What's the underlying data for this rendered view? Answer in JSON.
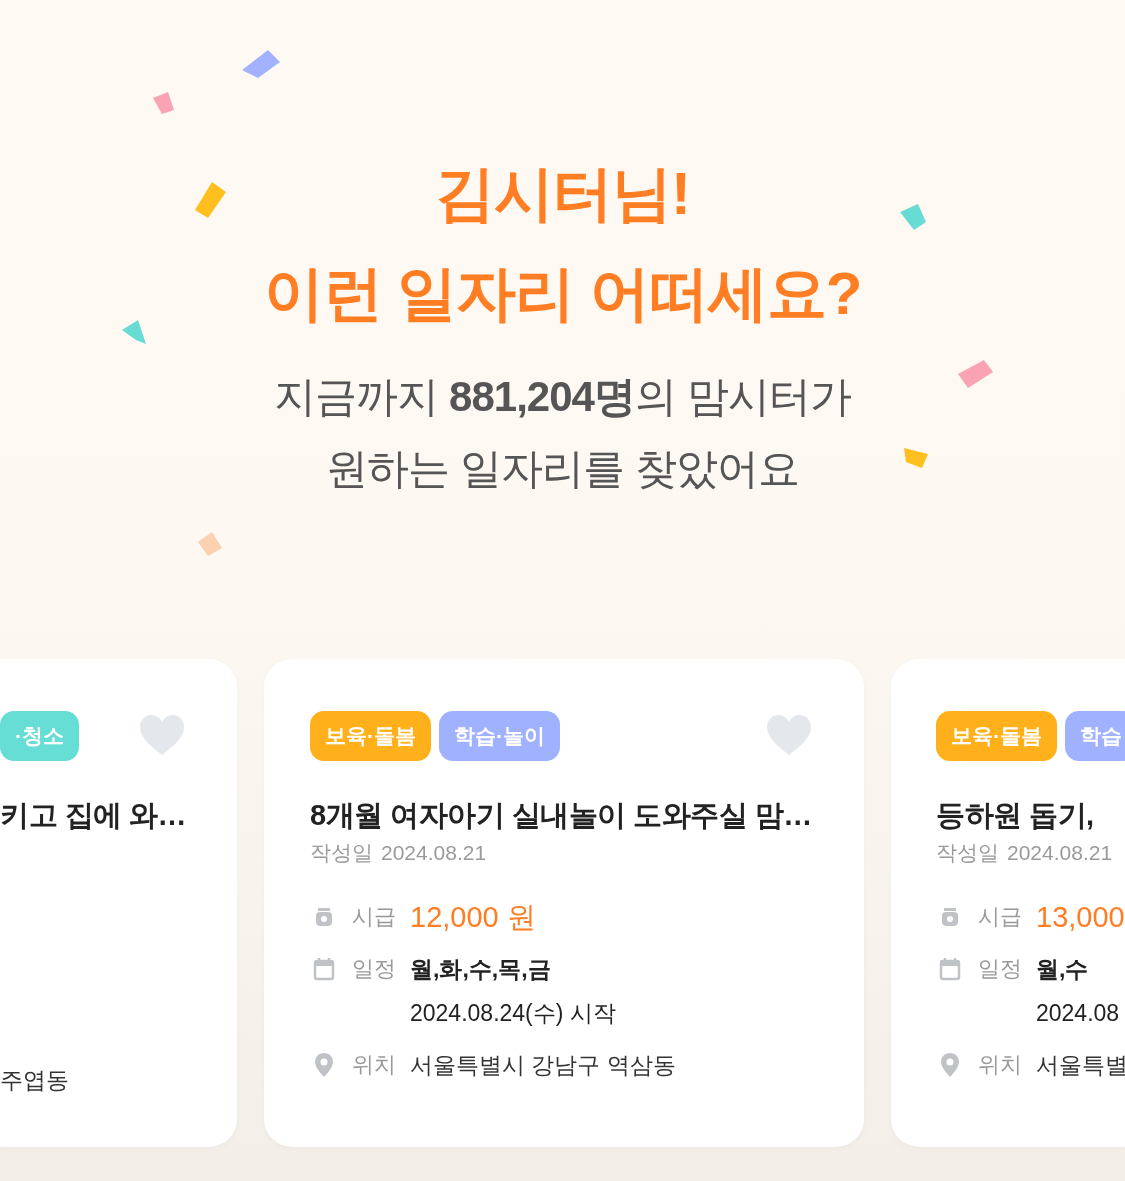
{
  "hero": {
    "title_lines": [
      "김시터님!",
      "이런 일자리 어떠세요?"
    ],
    "subtitle_lines": [
      "지금까지 **881,204명**의 맘시터가",
      "원하는 일자리를 찾았어요"
    ]
  },
  "cards": [
    {
      "kind": "cut-left",
      "liked": false,
      "tags": [
        {
          "label": "·청소",
          "color": "#66ddd5"
        }
      ],
      "title": "키고 집에 와…",
      "rows": [
        {
          "kind": "location",
          "value": "주엽동"
        }
      ]
    },
    {
      "kind": "whole",
      "liked": false,
      "tags": [
        {
          "label": "보육·돌봄",
          "color": "#ffb01a"
        },
        {
          "label": "학습·놀이",
          "color": "#9fb1ff"
        }
      ],
      "title": "8개월 여자아기 실내놀이 도와주실 맘…",
      "date_label": "작성일",
      "date": "2024.08.21",
      "rows": [
        {
          "kind": "wage",
          "label": "시급",
          "value": "12,000 원"
        },
        {
          "kind": "schedule",
          "label": "일정",
          "value": "월,화,수,목,금",
          "detail": "2024.08.24(수) 시작"
        },
        {
          "kind": "location",
          "label": "위치",
          "value": "서울특별시 강남구 역삼동"
        }
      ]
    },
    {
      "kind": "cut-right",
      "tags": [
        {
          "label": "보육·돌봄",
          "color": "#ffb01a"
        },
        {
          "label": "학습",
          "color": "#9fb1ff"
        }
      ],
      "title": "등하원 돕기,",
      "date_label": "작성일",
      "date": "2024.08.21",
      "rows": [
        {
          "kind": "wage",
          "label": "시급",
          "value": "13,000"
        },
        {
          "kind": "schedule",
          "label": "일정",
          "value": "월,수",
          "detail": "2024.08"
        },
        {
          "kind": "location",
          "label": "위치",
          "value": "서울특별"
        }
      ]
    }
  ]
}
